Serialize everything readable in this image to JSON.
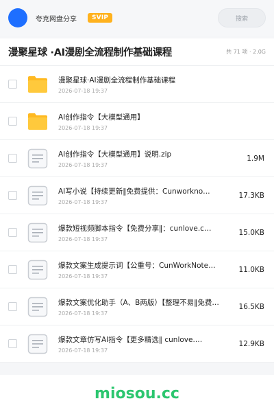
{
  "header": {
    "site_name": "夸克网盘分享",
    "badge": "SVIP",
    "search_placeholder": "搜索"
  },
  "title_bar": {
    "title": "漫聚星球 ·AI漫剧全流程制作基础课程",
    "meta": "共 71 项 · 2.0G"
  },
  "files": [
    {
      "type": "folder",
      "name": "漫聚星球·AI漫剧全流程制作基础课程",
      "date": "2026-07-18 19:37",
      "size": ""
    },
    {
      "type": "folder",
      "name": "AI创作指令【大模型通用】",
      "date": "2026-07-18 19:37",
      "size": ""
    },
    {
      "type": "file",
      "name": "AI创作指令【大模型通用】说明.zip",
      "date": "2026-07-18 19:37",
      "size": "1.9M"
    },
    {
      "type": "file",
      "name": "AI写小说【持续更新‖免费提供：Cunworkno…",
      "date": "2026-07-18 19:37",
      "size": "17.3KB"
    },
    {
      "type": "file",
      "name": "爆款短视频脚本指令【免费分享‖：cunlove.c…",
      "date": "2026-07-18 19:37",
      "size": "15.0KB"
    },
    {
      "type": "file",
      "name": "爆款文案生成提示词【公重号：CunWorkNote…",
      "date": "2026-07-18 19:37",
      "size": "11.0KB"
    },
    {
      "type": "file",
      "name": "爆款文案优化助手（A、B两版）【整理不易‖免费奉上…",
      "date": "2026-07-18 19:37",
      "size": "16.5KB"
    },
    {
      "type": "file",
      "name": "爆款文章仿写AI指令【更多精选‖ cunlove.…",
      "date": "2026-07-18 19:37",
      "size": "12.9KB"
    }
  ],
  "footer": {
    "watermark": "miosou.cc"
  },
  "colors": {
    "avatar": "#1e6fff",
    "badge": "#ffb21e",
    "folder": "#ffc93c",
    "watermark": "#2cc66f"
  }
}
